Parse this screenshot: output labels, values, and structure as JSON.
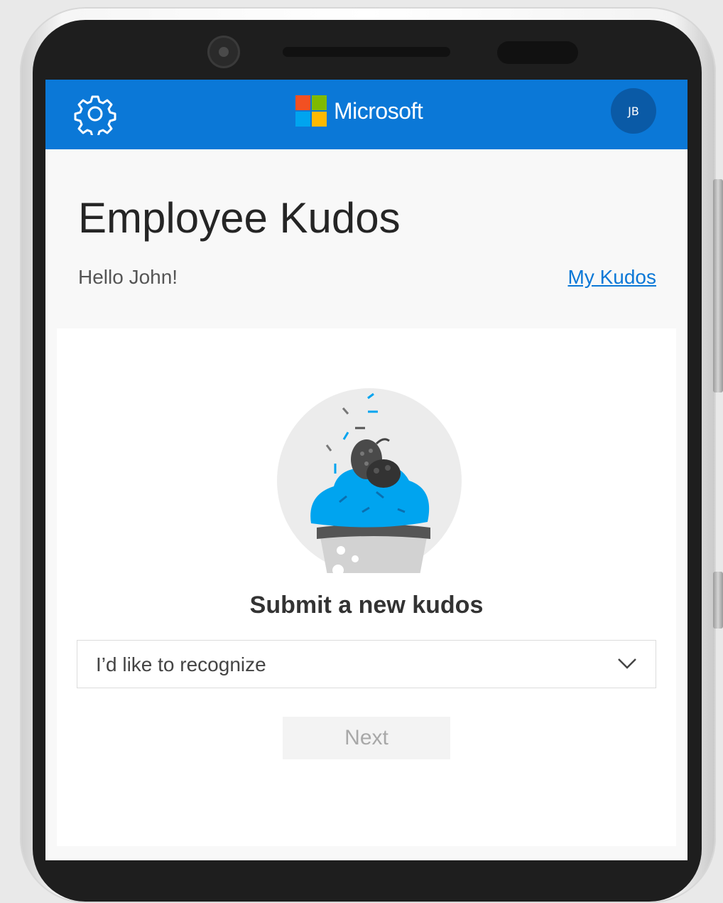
{
  "header": {
    "brand_name": "Microsoft",
    "brand_colors": [
      "#f25022",
      "#7fba00",
      "#00a4ef",
      "#ffb900"
    ],
    "settings_icon": "gear-icon",
    "avatar_initials": "JB",
    "bar_color": "#0b78d7"
  },
  "page": {
    "title": "Employee Kudos",
    "greeting": "Hello John!",
    "my_kudos_link": "My Kudos"
  },
  "card": {
    "illustration": "cupcake-illustration",
    "title": "Submit a new kudos",
    "recipient_dropdown": {
      "value": "I’d like to recognize",
      "icon": "chevron-down-icon"
    },
    "next_button": "Next"
  }
}
